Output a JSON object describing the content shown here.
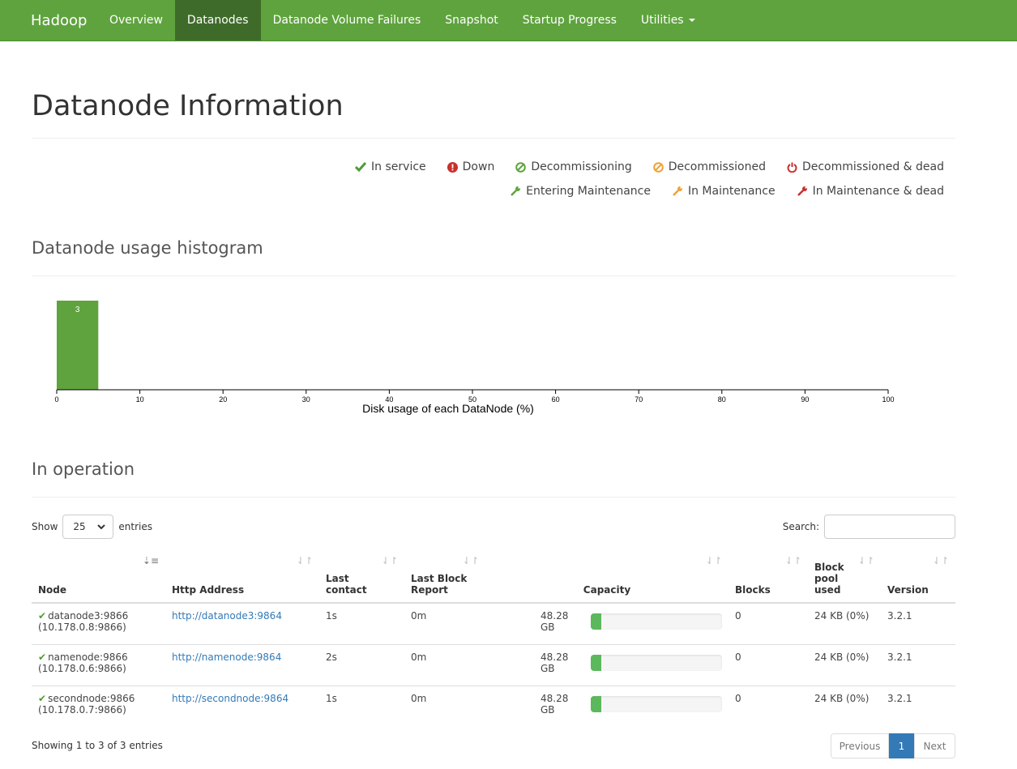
{
  "nav": {
    "brand": "Hadoop",
    "items": [
      {
        "label": "Overview"
      },
      {
        "label": "Datanodes"
      },
      {
        "label": "Datanode Volume Failures"
      },
      {
        "label": "Snapshot"
      },
      {
        "label": "Startup Progress"
      },
      {
        "label": "Utilities"
      }
    ]
  },
  "page_title": "Datanode Information",
  "legend": {
    "in_service": "In service",
    "down": "Down",
    "decommissioning": "Decommissioning",
    "decommissioned": "Decommissioned",
    "decommissioned_dead": "Decommissioned & dead",
    "entering_maintenance": "Entering Maintenance",
    "in_maintenance": "In Maintenance",
    "in_maintenance_dead": "In Maintenance & dead"
  },
  "histogram_title": "Datanode usage histogram",
  "chart_data": {
    "type": "bar",
    "bins": [
      {
        "x0": 0,
        "x1": 5,
        "count": 3
      }
    ],
    "xlabel": "Disk usage of each DataNode (%)",
    "xticks": [
      0,
      10,
      20,
      30,
      40,
      50,
      60,
      70,
      80,
      90,
      100
    ],
    "xlim": [
      0,
      100
    ],
    "bar_color": "#5fa33e"
  },
  "in_operation_title": "In operation",
  "controls": {
    "show_label": "Show",
    "entries_label": "entries",
    "page_size": "25",
    "search_label": "Search:"
  },
  "table": {
    "headers": {
      "node": "Node",
      "http": "Http Address",
      "last_contact_1": "Last",
      "last_contact_2": "contact",
      "last_block_1": "Last Block",
      "last_block_2": "Report",
      "capacity": "Capacity",
      "blocks": "Blocks",
      "pool_1": "Block",
      "pool_2": "pool",
      "pool_3": "used",
      "version": "Version"
    },
    "rows": [
      {
        "node": "datanode3:9866",
        "ip": "(10.178.0.8:9866)",
        "http": "http://datanode3:9864",
        "last_contact": "1s",
        "last_block": "0m",
        "capacity": "48.28 GB",
        "used_pct": 0,
        "blocks": "0",
        "pool": "24 KB (0%)",
        "version": "3.2.1"
      },
      {
        "node": "namenode:9866",
        "ip": "(10.178.0.6:9866)",
        "http": "http://namenode:9864",
        "last_contact": "2s",
        "last_block": "0m",
        "capacity": "48.28 GB",
        "used_pct": 0,
        "blocks": "0",
        "pool": "24 KB (0%)",
        "version": "3.2.1"
      },
      {
        "node": "secondnode:9866",
        "ip": "(10.178.0.7:9866)",
        "http": "http://secondnode:9864",
        "last_contact": "1s",
        "last_block": "0m",
        "capacity": "48.28 GB",
        "used_pct": 0,
        "blocks": "0",
        "pool": "24 KB (0%)",
        "version": "3.2.1"
      }
    ]
  },
  "footer": {
    "info": "Showing 1 to 3 of 3 entries",
    "previous": "Previous",
    "page": "1",
    "next": "Next"
  }
}
